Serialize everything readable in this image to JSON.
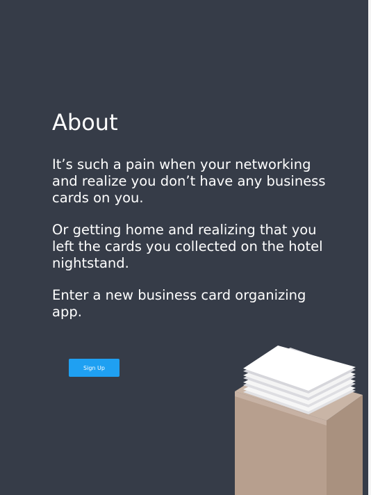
{
  "about": {
    "title": "About",
    "paragraphs": [
      "It’s such a pain when your networking and realize you don’t have any business cards on you.",
      "Or getting home and realizing that you left the cards you collected on the hotel nightstand.",
      "Enter a new business card organizing app."
    ],
    "signup_label": "Sign Up"
  },
  "colors": {
    "background": "#363c48",
    "button": "#1fa0f2",
    "box_front": "#b79f8e",
    "box_side": "#a9917f",
    "cards": "#ffffff"
  },
  "icons": {
    "illustration": "business-cards-stack-on-box"
  }
}
